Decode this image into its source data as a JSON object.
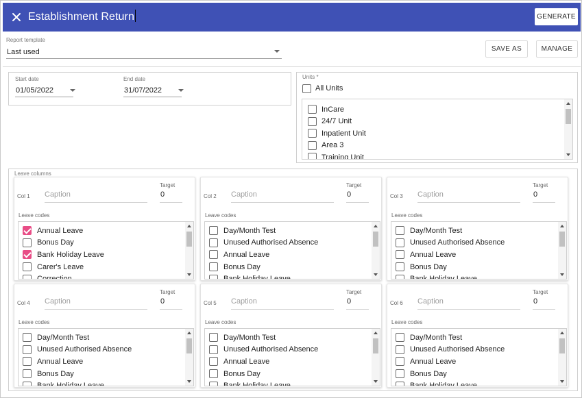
{
  "header": {
    "title": "Establishment Return",
    "generate_label": "GENERATE",
    "color": "#3f51b5"
  },
  "template": {
    "label": "Report template",
    "value": "Last used",
    "save_as_label": "SAVE AS",
    "manage_label": "MANAGE"
  },
  "dates": {
    "start_label": "Start date",
    "start_value": "01/05/2022",
    "end_label": "End date",
    "end_value": "31/07/2022"
  },
  "units": {
    "label": "Units *",
    "all_units_label": "All Units",
    "items": [
      "InCare",
      "24/7 Unit",
      "Inpatient Unit",
      "Area 3",
      "Training Unit"
    ]
  },
  "leave_columns": {
    "legend": "Leave columns",
    "caption_placeholder": "Caption",
    "target_label": "Target",
    "codes_label": "Leave codes",
    "check_color": "#e84d86",
    "columns": [
      {
        "name": "Col 1",
        "target": "0",
        "codes": [
          {
            "label": "Annual Leave",
            "checked": true
          },
          {
            "label": "Bonus Day",
            "checked": false
          },
          {
            "label": "Bank Holiday Leave",
            "checked": true
          },
          {
            "label": "Carer's Leave",
            "checked": false
          },
          {
            "label": "Correction",
            "checked": false
          }
        ]
      },
      {
        "name": "Col 2",
        "target": "0",
        "codes": [
          {
            "label": "Day/Month Test",
            "checked": false
          },
          {
            "label": "Unused Authorised Absence",
            "checked": false
          },
          {
            "label": "Annual Leave",
            "checked": false
          },
          {
            "label": "Bonus Day",
            "checked": false
          },
          {
            "label": "Bank Holiday Leave",
            "checked": false
          }
        ]
      },
      {
        "name": "Col 3",
        "target": "0",
        "codes": [
          {
            "label": "Day/Month Test",
            "checked": false
          },
          {
            "label": "Unused Authorised Absence",
            "checked": false
          },
          {
            "label": "Annual Leave",
            "checked": false
          },
          {
            "label": "Bonus Day",
            "checked": false
          },
          {
            "label": "Bank Holiday Leave",
            "checked": false
          }
        ]
      },
      {
        "name": "Col 4",
        "target": "0",
        "codes": [
          {
            "label": "Day/Month Test",
            "checked": false
          },
          {
            "label": "Unused Authorised Absence",
            "checked": false
          },
          {
            "label": "Annual Leave",
            "checked": false
          },
          {
            "label": "Bonus Day",
            "checked": false
          },
          {
            "label": "Bank Holiday Leave",
            "checked": false
          }
        ]
      },
      {
        "name": "Col 5",
        "target": "0",
        "codes": [
          {
            "label": "Day/Month Test",
            "checked": false
          },
          {
            "label": "Unused Authorised Absence",
            "checked": false
          },
          {
            "label": "Annual Leave",
            "checked": false
          },
          {
            "label": "Bonus Day",
            "checked": false
          },
          {
            "label": "Bank Holiday Leave",
            "checked": false
          }
        ]
      },
      {
        "name": "Col 6",
        "target": "0",
        "codes": [
          {
            "label": "Day/Month Test",
            "checked": false
          },
          {
            "label": "Unused Authorised Absence",
            "checked": false
          },
          {
            "label": "Annual Leave",
            "checked": false
          },
          {
            "label": "Bonus Day",
            "checked": false
          },
          {
            "label": "Bank Holiday Leave",
            "checked": false
          }
        ]
      }
    ]
  }
}
